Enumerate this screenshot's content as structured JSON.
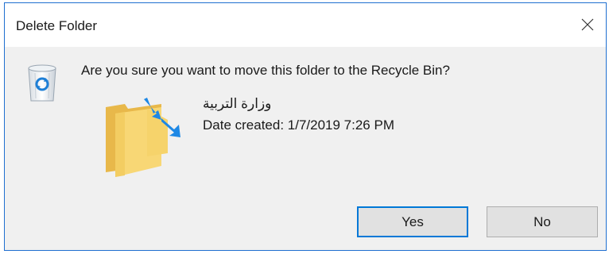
{
  "window": {
    "title": "Delete Folder",
    "close_icon": "close-icon"
  },
  "dialog": {
    "question": "Are you sure you want to move this folder to the Recycle Bin?",
    "recycle_icon": "recycle-bin-icon",
    "folder_icon": "folder-icon",
    "item": {
      "name": "وزارة التربية",
      "date_created": "Date created: 1/7/2019 7:26 PM"
    }
  },
  "buttons": {
    "yes_label": "Yes",
    "no_label": "No"
  },
  "colors": {
    "accent": "#0078d7",
    "window_border": "#1f6fd0",
    "content_bg": "#f0f0f0",
    "button_bg": "#e1e1e1",
    "folder_yellow": "#f8d775"
  }
}
